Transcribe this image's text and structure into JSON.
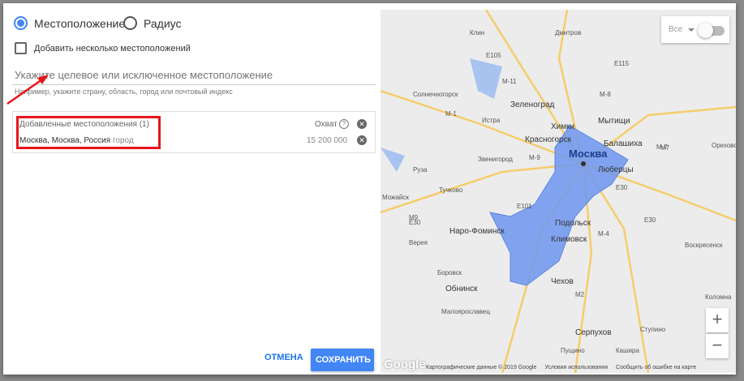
{
  "radio": {
    "location": "Местоположение",
    "radius": "Радиус"
  },
  "checkbox": {
    "label": "Добавить несколько местоположений"
  },
  "search": {
    "placeholder": "Укажите целевое или исключенное местоположение",
    "hint": "Например, укажите страну, область, город или почтовый индекс"
  },
  "added": {
    "header": "Добавленные местоположения (1)",
    "reach_label": "Охват",
    "item_name": "Москва, Москва, Россия",
    "item_type": "город",
    "item_reach": "15 200 000"
  },
  "buttons": {
    "cancel": "ОТМЕНА",
    "save": "СОХРАНИТЬ"
  },
  "map": {
    "filter": "Все",
    "zoom_in": "+",
    "zoom_out": "−",
    "google": "Google",
    "footer": [
      "Картографические данные © 2019 Google",
      "Условия использования",
      "Сообщить об ошибке на карте"
    ],
    "cities": [
      "Клин",
      "Дмитров",
      "Зеленоград",
      "Мытищи",
      "Истра",
      "Химки",
      "Красногорск",
      "Балашиха",
      "Москва",
      "Люберцы",
      "Орехово",
      "Звенигород",
      "Руза",
      "Тучково",
      "Можайск",
      "Наро-Фоминск",
      "Подольск",
      "Климовск",
      "Верея",
      "Боровск",
      "Обнинск",
      "Чехов",
      "Малоярославец",
      "Серпухов",
      "Пущино",
      "Кашира",
      "Воскресенск",
      "Коломна",
      "Солнечногорск",
      "Ступино"
    ],
    "roads": [
      "E105",
      "M-11",
      "E115",
      "M-8",
      "M-7",
      "M7",
      "M-9",
      "M9",
      "E30",
      "E101",
      "M-4",
      "M2",
      "M-1"
    ],
    "colors": {
      "polygon": "#6f97f0",
      "accent": "#4285f4"
    }
  }
}
